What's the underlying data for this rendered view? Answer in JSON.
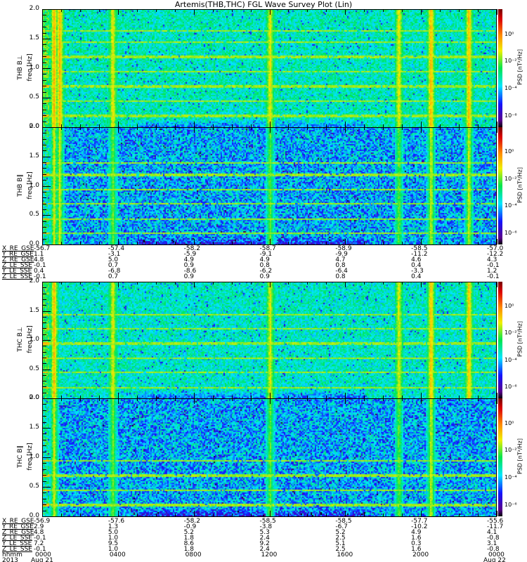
{
  "title": "Artemis(THB,THC) FGL Wave Survey Plot (Lin)",
  "colors": {
    "background": "#ffffff",
    "axis": "#000000"
  },
  "panels": [
    {
      "label": "THB B⊥",
      "ylabel": "freq [Hz]",
      "cbar_label": "PSD [nT²/Hz]"
    },
    {
      "label": "THB B∥",
      "ylabel": "freq [Hz]",
      "cbar_label": "PSD [nT²/Hz]"
    },
    {
      "label": "THC B⊥",
      "ylabel": "freq [Hz]",
      "cbar_label": "PSD [nT²/Hz]"
    },
    {
      "label": "THC B∥",
      "ylabel": "freq [Hz]",
      "cbar_label": "PSD [nT²/Hz]"
    }
  ],
  "yticks": [
    "0.0",
    "0.5",
    "1.0",
    "1.5",
    "2.0"
  ],
  "cbar_ticks": [
    "10⁰",
    "10⁻²",
    "10⁻⁴",
    "10⁻⁶"
  ],
  "ephem_thb": [
    {
      "name": "X_RE_GSE",
      "values": [
        "-56.7",
        "-57.4",
        "-58.2",
        "-58.7",
        "-58.9",
        "-58.5",
        "-57.0"
      ]
    },
    {
      "name": "Y_RE_GSE",
      "values": [
        "1.1",
        "-3.1",
        "-5.9",
        "-9.1",
        "-9.9",
        "-11.2",
        "-12.2"
      ]
    },
    {
      "name": "Z_RE_GSE",
      "values": [
        "4.8",
        "5.0",
        "4.9",
        "4.9",
        "4.7",
        "4.6",
        "4.3"
      ]
    },
    {
      "name": "Z_LE_SSE",
      "values": [
        "-0.1",
        "0.7",
        "0.9",
        "0.8",
        "0.8",
        "0.4",
        "-0.1"
      ]
    },
    {
      "name": "Y_LE_SSE",
      "values": [
        "0.4",
        "-6.8",
        "-8.6",
        "-6.2",
        "-6.4",
        "-3.3",
        "1.2"
      ]
    },
    {
      "name": "Z_LE_SSE",
      "values": [
        "-0.1",
        "0.7",
        "0.9",
        "0.9",
        "0.8",
        "0.4",
        "-0.1"
      ]
    }
  ],
  "ephem_thc": [
    {
      "name": "X_RE_GSE",
      "values": [
        "-56.9",
        "-57.6",
        "-58.2",
        "-58.5",
        "-58.5",
        "-57.7",
        "-55.6"
      ]
    },
    {
      "name": "Y_RE_GSE",
      "values": [
        "2.9",
        "1.3",
        "-0.9",
        "-3.8",
        "-6.7",
        "-10.2",
        "-11.7"
      ]
    },
    {
      "name": "Z_RE_GSE",
      "values": [
        "4.8",
        "5.0",
        "5.2",
        "5.3",
        "5.2",
        "4.9",
        "4.1"
      ]
    },
    {
      "name": "Z_LE_SSE",
      "values": [
        "-0.1",
        "1.0",
        "1.8",
        "2.4",
        "2.5",
        "1.6",
        "-0.8"
      ]
    },
    {
      "name": "Y_LE_SSE",
      "values": [
        "7.2",
        "9.5",
        "8.6",
        "9.2",
        "5.1",
        "0.3",
        "3.1"
      ]
    },
    {
      "name": "Z_LE_SSE",
      "values": [
        "-0.1",
        "1.0",
        "1.8",
        "2.4",
        "2.5",
        "1.6",
        "-0.8"
      ]
    }
  ],
  "time_axis": {
    "name": "hhmm",
    "values": [
      "0000",
      "0400",
      "0800",
      "1200",
      "1600",
      "2000",
      "0000"
    ],
    "year": "2013",
    "start_date": "Aug 21",
    "end_date": "Aug 22"
  },
  "chart_data": {
    "type": "heatmap",
    "title": "Artemis(THB,THC) FGL Wave Survey Plot (Lin)",
    "xlabel": "hhmm",
    "x_range_hours": [
      0,
      24
    ],
    "ylabel": "freq [Hz]",
    "ylim": [
      0,
      2.0
    ],
    "color_scale": "log10 PSD [nT²/Hz]",
    "clim_log10": [
      -6.8,
      1.9
    ],
    "series": [
      {
        "name": "THB B⊥",
        "background_log10": -3.2,
        "harmonic_lines_hz": [
          0.2,
          0.45,
          0.7,
          0.95,
          1.2,
          1.45,
          1.65
        ],
        "burst_hours": [
          0.6,
          0.9,
          3.7,
          12.0,
          18.8,
          20.5,
          22.5
        ]
      },
      {
        "name": "THB B∥",
        "background_log10": -4.0,
        "harmonic_lines_hz": [
          0.2,
          0.45,
          0.7,
          0.95,
          1.2,
          1.4
        ],
        "burst_hours": [
          0.6,
          0.9,
          3.7,
          12.0,
          18.8,
          20.5,
          22.5
        ]
      },
      {
        "name": "THC B⊥",
        "background_log10": -3.3,
        "harmonic_lines_hz": [
          0.2,
          0.45,
          0.7,
          0.95,
          1.2,
          1.45
        ],
        "burst_hours": [
          0.6,
          3.7,
          12.0,
          18.8,
          20.5,
          22.5
        ]
      },
      {
        "name": "THC B∥",
        "background_log10": -4.0,
        "harmonic_lines_hz": [
          0.2,
          0.45,
          0.7,
          0.95
        ],
        "burst_hours": [
          0.6,
          3.7,
          12.0,
          18.8,
          20.5
        ]
      }
    ]
  }
}
